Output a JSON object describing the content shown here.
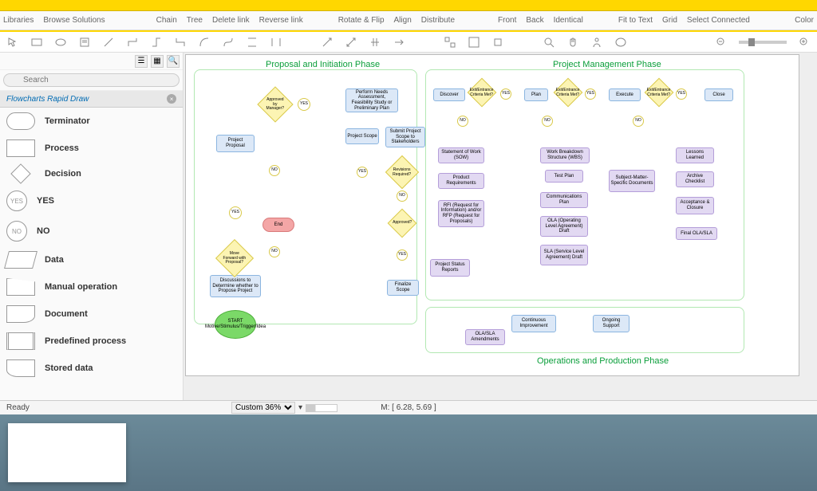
{
  "toolbar": {
    "items": [
      "Libraries",
      "Browse Solutions",
      "Chain",
      "Tree",
      "Delete link",
      "Reverse link",
      "Rotate & Flip",
      "Align",
      "Distribute",
      "Front",
      "Back",
      "Identical",
      "Fit to Text",
      "Grid",
      "Select Connected",
      "Color"
    ]
  },
  "sidebar": {
    "search_placeholder": "Search",
    "palette_title": "Flowcharts Rapid Draw",
    "shapes": [
      {
        "label": "Terminator",
        "type": "terminator"
      },
      {
        "label": "Process",
        "type": "process"
      },
      {
        "label": "Decision",
        "type": "decision"
      },
      {
        "label": "YES",
        "type": "yes"
      },
      {
        "label": "NO",
        "type": "no"
      },
      {
        "label": "Data",
        "type": "data"
      },
      {
        "label": "Manual operation",
        "type": "manual"
      },
      {
        "label": "Document",
        "type": "document"
      },
      {
        "label": "Predefined process",
        "type": "predefined"
      },
      {
        "label": "Stored data",
        "type": "stored"
      }
    ]
  },
  "canvas": {
    "phase1_title": "Proposal and Initiation Phase",
    "phase2_title": "Project Management Phase",
    "phase3_title": "Operations and Production Phase",
    "nodes": {
      "start": "START Motive/Stimulus/Trigger/Idea",
      "discuss": "Discussions to Determine whether to Propose Project",
      "forward": "Move Forward with Proposal?",
      "proposal": "Project Proposal",
      "approved_mgr": "Approved by Manager?",
      "needs": "Perform Needs Assessment, Feasibility Study or Preliminary Plan",
      "scope": "Project Scope",
      "submit": "Submit Project Scope to Stakeholders",
      "revisions": "Revisions Required?",
      "approved": "Approved?",
      "finalize": "Finalize Scope",
      "end": "End",
      "discover": "Discover",
      "plan": "Plan",
      "execute": "Execute",
      "close": "Close",
      "exit_criteria": "Exit/Entrance Criteria Met?",
      "sow": "Statement of Work (SOW)",
      "prod_req": "Product Requirements",
      "rfi": "RFI (Request for Information) and/or RFP (Request for Proposals)",
      "status": "Project Status Reports",
      "wbs": "Work Breakdown Structure (WBS)",
      "test_plan": "Test Plan",
      "comm_plan": "Communications Plan",
      "ola": "OLA (Operating Level Agreement) Draft",
      "sla": "SLA (Service Level Agreement) Draft",
      "sme": "Subject-Matter-Specific Documents",
      "lessons": "Lessons Learned",
      "archive": "Archive Checklist",
      "acceptance": "Acceptance & Closure",
      "final_ola": "Final OLA/SLA",
      "cont_improve": "Continuous Improvement",
      "support": "Ongoing Support",
      "amendments": "OLA/SLA Amendments",
      "yes": "YES",
      "no": "NO"
    }
  },
  "status": {
    "ready": "Ready",
    "zoom": "Custom 36%",
    "mouse": "M: [ 6.28, 5.69 ]"
  }
}
